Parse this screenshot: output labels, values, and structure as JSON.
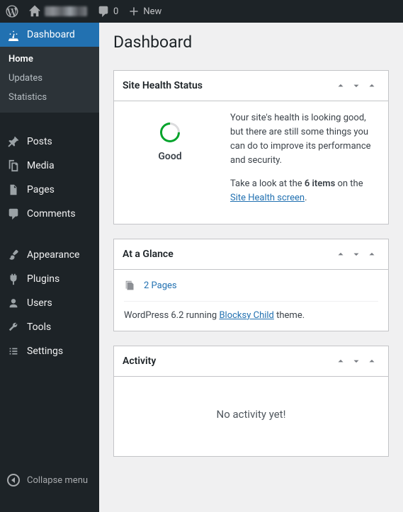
{
  "adminbar": {
    "comments_count": "0",
    "new_label": "New"
  },
  "sidebar": {
    "dashboard": "Dashboard",
    "submenu": {
      "home": "Home",
      "updates": "Updates",
      "statistics": "Statistics"
    },
    "posts": "Posts",
    "media": "Media",
    "pages": "Pages",
    "comments": "Comments",
    "appearance": "Appearance",
    "plugins": "Plugins",
    "users": "Users",
    "tools": "Tools",
    "settings": "Settings",
    "collapse": "Collapse menu"
  },
  "page": {
    "title": "Dashboard"
  },
  "site_health": {
    "title": "Site Health Status",
    "status": "Good",
    "text1": "Your site's health is looking good, but there are still some things you can do to improve its performance and security.",
    "text2_prefix": "Take a look at the ",
    "items_bold": "6 items",
    "text2_mid": " on the ",
    "link": "Site Health screen",
    "text2_suffix": "."
  },
  "glance": {
    "title": "At a Glance",
    "pages_count": "2 Pages",
    "wp_prefix": "WordPress 6.2 running ",
    "theme_link": "Blocksy Child",
    "wp_suffix": " theme."
  },
  "activity": {
    "title": "Activity",
    "empty": "No activity yet!"
  }
}
